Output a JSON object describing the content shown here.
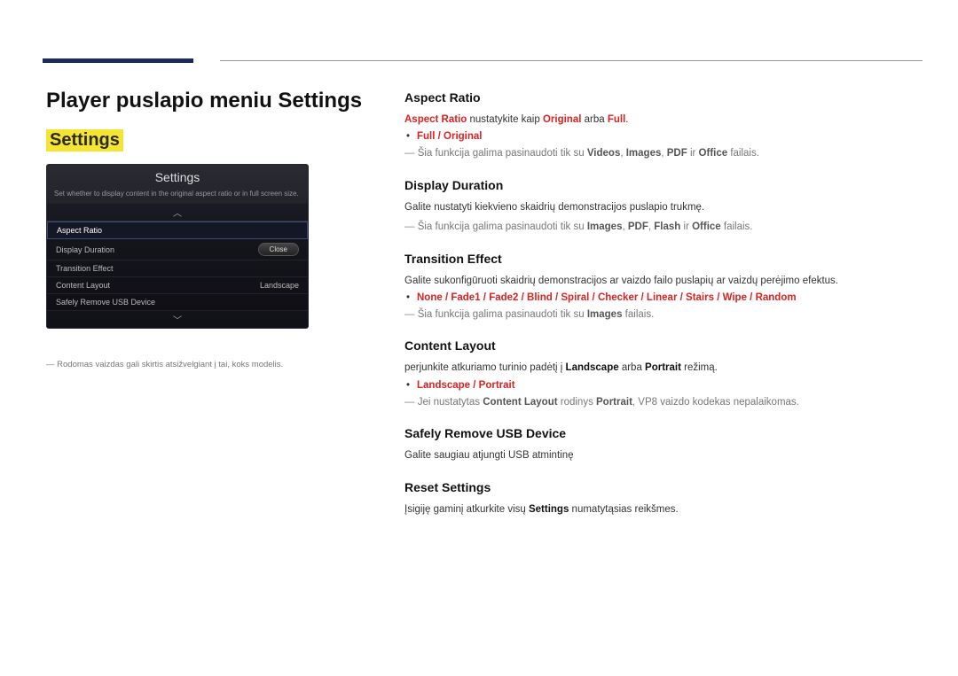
{
  "page_title": "Player puslapio meniu Settings",
  "settings_highlight": "Settings",
  "panel": {
    "title": "Settings",
    "description": "Set whether to display content in the original aspect ratio or in full screen size.",
    "items": {
      "aspect_ratio": "Aspect Ratio",
      "display_duration": "Display Duration",
      "transition_effect": "Transition Effect",
      "content_layout": "Content Layout",
      "content_layout_value": "Landscape",
      "safely_remove": "Safely Remove USB Device"
    },
    "close_label": "Close"
  },
  "caption_note": "Rodomas vaizdas gali skirtis atsižvelgiant į tai, koks modelis.",
  "sections": {
    "aspect_ratio": {
      "heading": "Aspect Ratio",
      "line1_pre": "Aspect Ratio",
      "line1_mid": " nustatykite kaip ",
      "line1_opt1": "Original",
      "line1_or": " arba ",
      "line1_opt2": "Full",
      "bullet1_a": "Full",
      "bullet1_sep": " / ",
      "bullet1_b": "Original",
      "note_pre": "Šia funkcija galima pasinaudoti tik su ",
      "note_v": "Videos",
      "note_i": "Images",
      "note_p": "PDF",
      "note_ir": " ir ",
      "note_o": "Office",
      "note_post": " failais."
    },
    "display_duration": {
      "heading": "Display Duration",
      "desc": "Galite nustatyti kiekvieno skaidrių demonstracijos puslapio trukmę.",
      "note_pre": "Šia funkcija galima pasinaudoti tik su ",
      "note_i": "Images",
      "note_p": "PDF",
      "note_f": "Flash",
      "note_ir": " ir ",
      "note_o": "Office",
      "note_post": " failais."
    },
    "transition_effect": {
      "heading": "Transition Effect",
      "desc": "Galite sukonfigūruoti skaidrių demonstracijos ar vaizdo failo puslapių ar vaizdų perėjimo efektus.",
      "b_none": "None",
      "b_fade1": "Fade1",
      "b_fade2": "Fade2",
      "b_blind": "Blind",
      "b_spiral": "Spiral",
      "b_checker": "Checker",
      "b_linear": "Linear",
      "b_stairs": "Stairs",
      "b_wipe": "Wipe",
      "b_random": "Random",
      "sep": " / ",
      "note_pre": "Šia funkcija galima pasinaudoti tik su ",
      "note_i": "Images",
      "note_post": " failais."
    },
    "content_layout": {
      "heading": "Content Layout",
      "desc_pre": "perjunkite atkuriamo turinio padėtį į ",
      "desc_l": "Landscape",
      "desc_or": " arba ",
      "desc_p": "Portrait",
      "desc_post": " režimą.",
      "b_l": "Landscape",
      "b_sep": " / ",
      "b_p": "Portrait",
      "note_pre": "Jei nustatytas ",
      "note_cl": "Content Layout",
      "note_mid": " rodinys ",
      "note_po": "Portrait",
      "note_post": ", VP8 vaizdo kodekas nepalaikomas."
    },
    "safely_remove": {
      "heading": "Safely Remove USB Device",
      "desc": "Galite saugiau atjungti USB atmintinę"
    },
    "reset_settings": {
      "heading": "Reset Settings",
      "desc_pre": "Įsigiję gaminį atkurkite visų ",
      "desc_s": "Settings",
      "desc_post": " numatytąsias reikšmes."
    }
  },
  "sep_comma": ", "
}
